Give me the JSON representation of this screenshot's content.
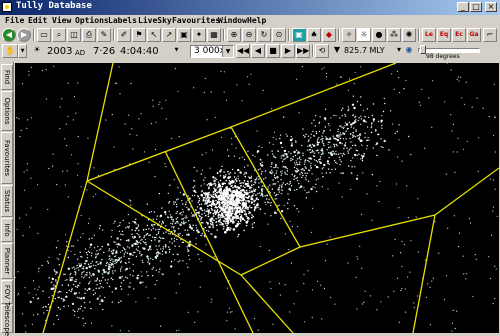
{
  "window": {
    "title": "Tully Database",
    "controls": [
      "_",
      "□",
      "×"
    ]
  },
  "menu": [
    "File",
    "Edit",
    "View",
    "Options",
    "Labels",
    "LiveSky",
    "Favourites",
    "Window",
    "Help"
  ],
  "toolbar": {
    "label_buttons": [
      "Le",
      "Eq",
      "Ec",
      "Ga"
    ]
  },
  "timebar": {
    "year": "2003",
    "era": "AD",
    "date": "7·26",
    "time": "4:04:40",
    "speed": "3 000x",
    "distance": "825.7 MLY",
    "fov": "98 degrees"
  },
  "side_tabs": [
    "Find",
    "Options",
    "Favourites",
    "Status",
    "Info",
    "Planner",
    "FOV",
    "Telescope"
  ],
  "colors": {
    "title_start": "#0a246a",
    "title_end": "#a6caf0",
    "box_lines": "#e8e000",
    "sky": "#000000"
  }
}
